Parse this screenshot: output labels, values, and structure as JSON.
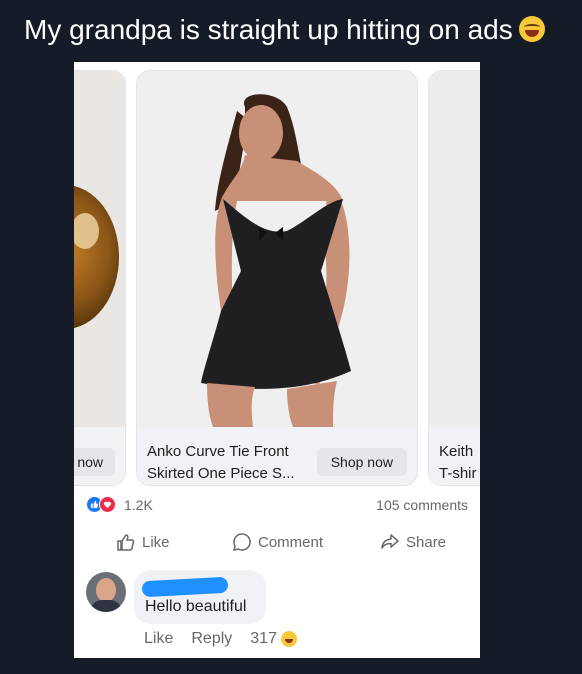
{
  "tweet": {
    "text": "My grandpa is straight up hitting on ads",
    "emoji": "laughing-crying-emoji"
  },
  "carousel": {
    "left_card": {
      "cta": "now",
      "image": "round-amber-object-photo"
    },
    "main_card": {
      "title": "Anko Curve Tie Front Skirted One Piece S...",
      "cta": "Shop now",
      "image": "model-in-black-swim-dress-photo"
    },
    "right_card": {
      "title_line1": "Keith",
      "title_line2": "T-shir"
    }
  },
  "stats": {
    "reactions": [
      "like",
      "love"
    ],
    "reaction_count": "1.2K",
    "comments": "105 comments"
  },
  "actions": {
    "like": "Like",
    "comment": "Comment",
    "share": "Share"
  },
  "comment": {
    "author": "",
    "text": "Hello beautiful",
    "like": "Like",
    "reply": "Reply",
    "reaction_count": "317",
    "reaction_emoji": "grinning-emoji"
  },
  "colors": {
    "background": "#151b27",
    "fb_blue": "#1877f2",
    "love_red": "#f02849",
    "text_gray": "#65676b"
  }
}
